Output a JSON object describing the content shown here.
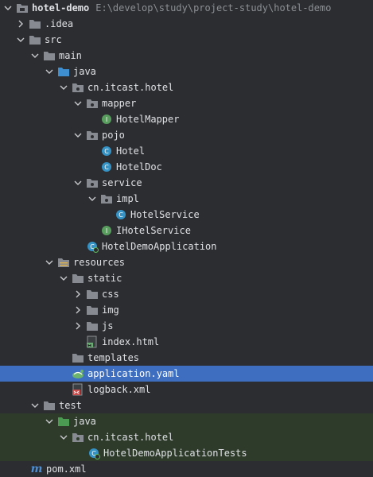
{
  "tree": {
    "project": {
      "name": "hotel-demo",
      "path": "E:\\develop\\study\\project-study\\hotel-demo"
    },
    "idea": ".idea",
    "src": "src",
    "main": "main",
    "main_java": "java",
    "pkg": "cn.itcast.hotel",
    "mapper": "mapper",
    "hotel_mapper": "HotelMapper",
    "pojo": "pojo",
    "hotel": "Hotel",
    "hotel_doc": "HotelDoc",
    "service": "service",
    "impl": "impl",
    "hotel_service": "HotelService",
    "ihotel_service": "IHotelService",
    "app": "HotelDemoApplication",
    "resources": "resources",
    "static": "static",
    "css": "css",
    "img": "img",
    "js": "js",
    "index_html": "index.html",
    "templates": "templates",
    "application_yaml": "application.yaml",
    "logback_xml": "logback.xml",
    "test": "test",
    "test_java": "java",
    "test_pkg": "cn.itcast.hotel",
    "app_tests": "HotelDemoApplicationTests",
    "pom_xml": "pom.xml"
  },
  "badges": {
    "class": "C",
    "interface": "I",
    "maven": "m"
  },
  "colors": {
    "background": "#2b2d30",
    "selected_row": "#3e6ec0",
    "test_rows": "#2e3b2b",
    "folder": "#878b91",
    "source_folder": "#4b9b53",
    "class_badge": "#3592c4",
    "interface_badge": "#599e5e"
  }
}
